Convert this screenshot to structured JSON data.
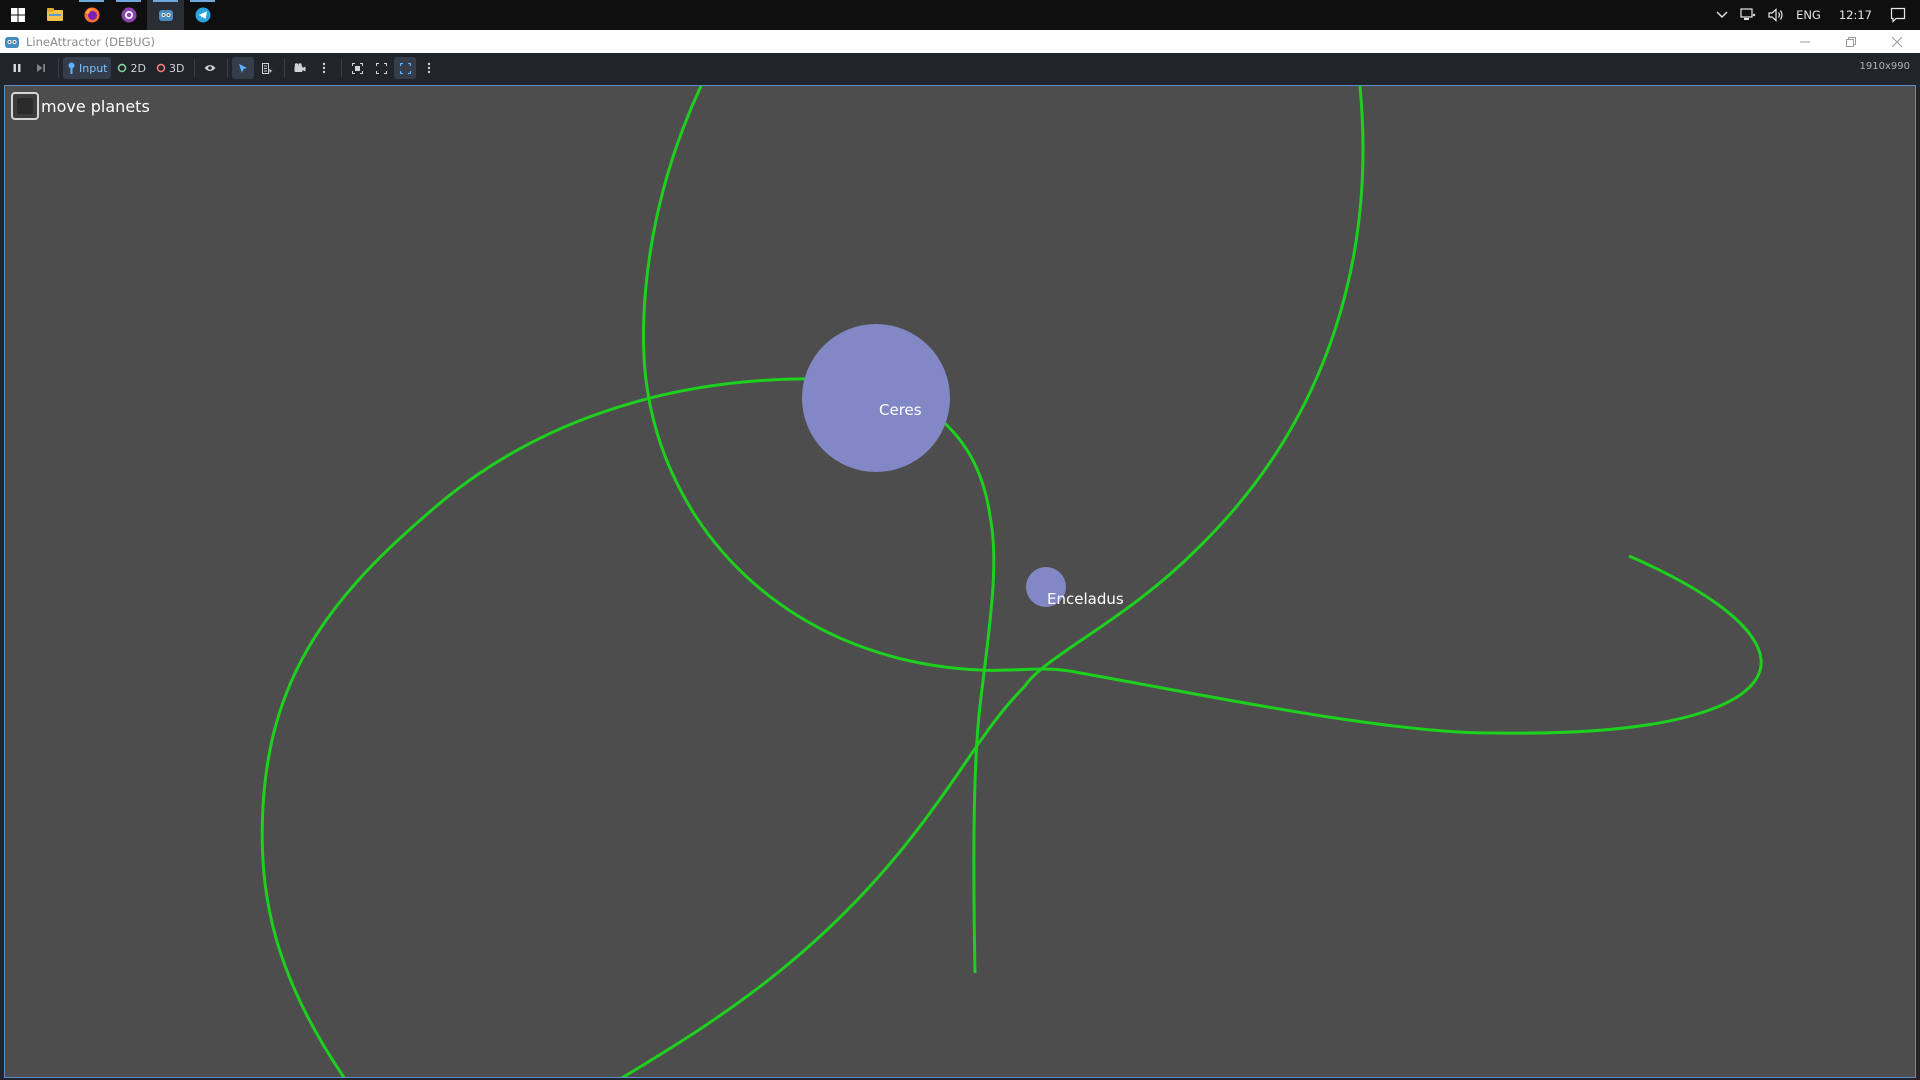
{
  "taskbar": {
    "apps": [
      {
        "name": "file-explorer-icon",
        "running": false
      },
      {
        "name": "firefox-icon",
        "running": true
      },
      {
        "name": "github-desktop-icon",
        "running": true
      },
      {
        "name": "godot-icon",
        "running": true,
        "active": true
      },
      {
        "name": "telegram-icon",
        "running": true
      }
    ],
    "tray": {
      "language": "ENG",
      "time": "12:17"
    }
  },
  "window": {
    "title": "LineAttractor (DEBUG)"
  },
  "toolbar": {
    "input_label": "Input",
    "mode_2d_label": "2D",
    "mode_3d_label": "3D",
    "resolution": "1910x990"
  },
  "game": {
    "checkbox_label": "move planets",
    "checkbox_checked": false,
    "planets": [
      {
        "name": "Ceres",
        "color": "#8288c5"
      },
      {
        "name": "Enceladus",
        "color": "#8288c5"
      }
    ],
    "trail_color": "#1ed01e",
    "background_color": "#4d4d4d"
  }
}
